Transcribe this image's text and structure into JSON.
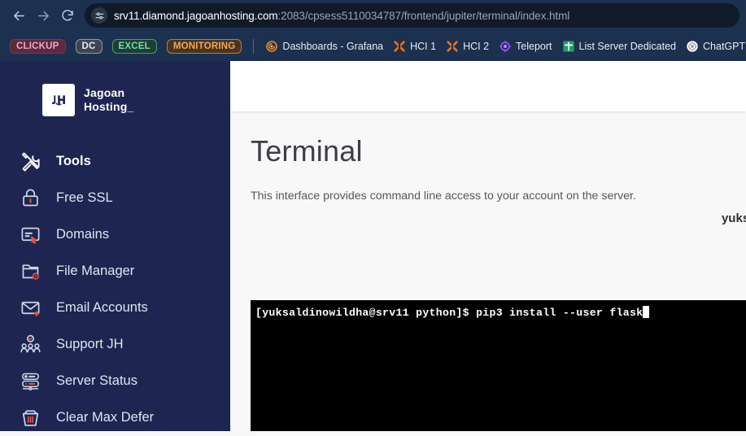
{
  "browser": {
    "nav": {
      "back_icon": "arrow-left-icon",
      "forward_icon": "arrow-right-icon",
      "reload_icon": "reload-icon"
    },
    "omnibox": {
      "site_info_icon": "site-settings-icon",
      "host": "srv11.diamond.jagoanhosting.com",
      "path": ":2083/cpsess5110034787/frontend/jupiter/terminal/index.html"
    },
    "bookmarks": [
      {
        "label": "CLICKUP",
        "style": "chip-clickup",
        "icon": ""
      },
      {
        "label": "DC",
        "style": "chip-dc",
        "icon": ""
      },
      {
        "label": "EXCEL",
        "style": "chip-excel",
        "icon": ""
      },
      {
        "label": "MONITORING",
        "style": "chip-mon",
        "icon": ""
      },
      {
        "label": "Dashboards - Grafana",
        "style": "",
        "icon": "grafana-icon"
      },
      {
        "label": "HCI 1",
        "style": "",
        "icon": "hci-x-icon"
      },
      {
        "label": "HCI 2",
        "style": "",
        "icon": "hci-x-icon"
      },
      {
        "label": "Teleport",
        "style": "",
        "icon": "teleport-icon"
      },
      {
        "label": "List Server Dedicated",
        "style": "",
        "icon": "green-cross-icon"
      },
      {
        "label": "ChatGPT",
        "style": "",
        "icon": "chatgpt-icon"
      }
    ]
  },
  "sidebar": {
    "logo": {
      "mark": "jh-monogram-icon",
      "text": "Jagoan\nHosting_"
    },
    "items": [
      {
        "label": "Tools",
        "icon": "tools-icon",
        "active": true
      },
      {
        "label": "Free SSL",
        "icon": "lock-icon",
        "active": false
      },
      {
        "label": "Domains",
        "icon": "domains-icon",
        "active": false
      },
      {
        "label": "File Manager",
        "icon": "file-manager-icon",
        "active": false
      },
      {
        "label": "Email Accounts",
        "icon": "email-icon",
        "active": false
      },
      {
        "label": "Support JH",
        "icon": "support-icon",
        "active": false
      },
      {
        "label": "Server Status",
        "icon": "server-icon",
        "active": false
      },
      {
        "label": "Clear Max Defer",
        "icon": "trash-icon",
        "active": false
      }
    ]
  },
  "main": {
    "title": "Terminal",
    "description": "This interface provides command line access to your account on the server.",
    "terminal_user": "yuksaldinowildha",
    "terminal": {
      "prompt": "[yuksaldinowildha@srv11 python]$ ",
      "command": "pip3 install --user flask"
    }
  },
  "colors": {
    "chrome": "#1c3050",
    "sidebar": "#1f2551",
    "terminal_bg": "#000000",
    "accent_orange": "#e8543f"
  }
}
